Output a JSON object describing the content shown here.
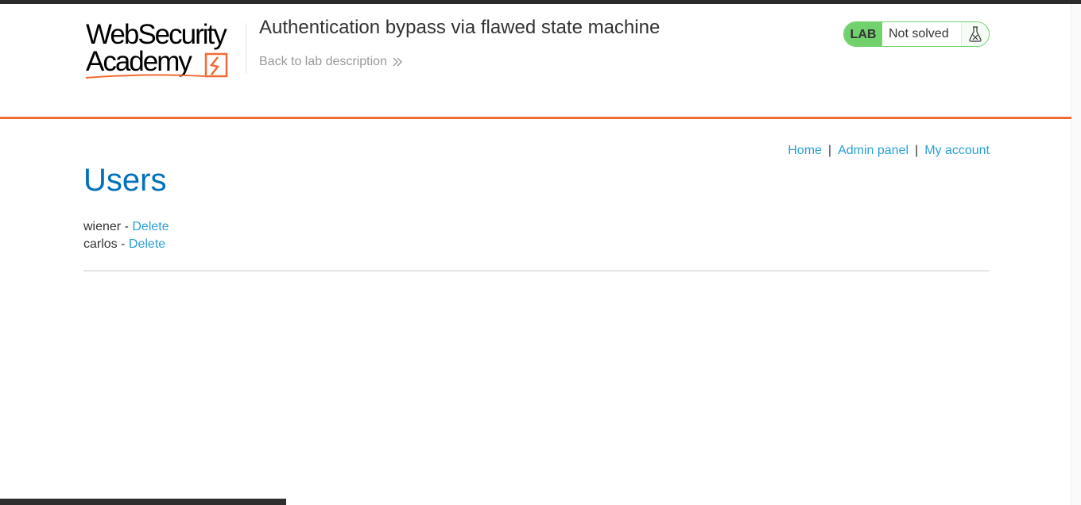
{
  "logo": {
    "line1": "WebSecurity",
    "line2": "Academy"
  },
  "header": {
    "lab_title": "Authentication bypass via flawed state machine",
    "back_link": "Back to lab description"
  },
  "status_widget": {
    "badge": "LAB",
    "status": "Not solved"
  },
  "nav": {
    "home": "Home",
    "admin_panel": "Admin panel",
    "my_account": "My account",
    "separator": "|"
  },
  "page": {
    "title": "Users",
    "users": [
      {
        "name": "wiener",
        "separator": "-",
        "action": "Delete"
      },
      {
        "name": "carlos",
        "separator": "-",
        "action": "Delete"
      }
    ]
  },
  "colors": {
    "brand_orange": "#f06a35",
    "link_blue": "#29a0d8",
    "title_blue": "#0071bc",
    "lab_green": "#70d16d"
  }
}
